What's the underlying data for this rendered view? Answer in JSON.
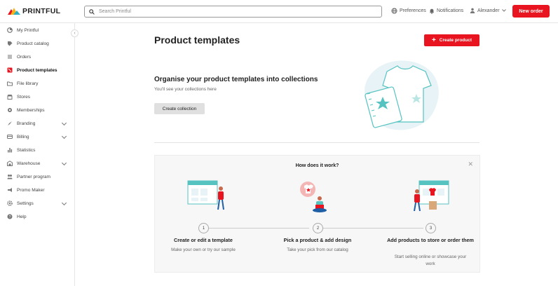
{
  "brand": {
    "name": "PRINTFUL",
    "accent": "#e8141f",
    "teal": "#56c3c1"
  },
  "header": {
    "search_placeholder": "Search Printful",
    "preferences": "Preferences",
    "notifications": "Notifications",
    "user": "Alexander",
    "new_order": "New order"
  },
  "sidebar": {
    "items": [
      {
        "label": "My Printful",
        "icon": "dashboard-icon"
      },
      {
        "label": "Product catalog",
        "icon": "tag-icon"
      },
      {
        "label": "Orders",
        "icon": "list-icon"
      },
      {
        "label": "Product templates",
        "icon": "template-icon",
        "active": true
      },
      {
        "label": "File library",
        "icon": "folder-icon"
      },
      {
        "label": "Stores",
        "icon": "store-icon"
      },
      {
        "label": "Memberships",
        "icon": "gear-badge-icon"
      },
      {
        "label": "Branding",
        "icon": "brush-icon",
        "expandable": true
      },
      {
        "label": "Billing",
        "icon": "card-icon",
        "expandable": true
      },
      {
        "label": "Statistics",
        "icon": "bar-chart-icon"
      },
      {
        "label": "Warehouse",
        "icon": "warehouse-icon",
        "expandable": true
      },
      {
        "label": "Partner program",
        "icon": "handshake-icon"
      },
      {
        "label": "Promo Maker",
        "icon": "megaphone-icon"
      },
      {
        "label": "Settings",
        "icon": "gear-icon",
        "expandable": true
      },
      {
        "label": "Help",
        "icon": "help-icon"
      }
    ]
  },
  "main": {
    "title": "Product templates",
    "create_product": "Create product",
    "org_title": "Organise your product templates into collections",
    "org_sub": "You'll see your collections here",
    "create_collection": "Create collection"
  },
  "how": {
    "title": "How does it work?",
    "steps": [
      {
        "num": "1",
        "title": "Create or edit a template",
        "desc": "Make your own or try our sample"
      },
      {
        "num": "2",
        "title": "Pick a product & add design",
        "desc": "Take your pick from our catalog"
      },
      {
        "num": "3",
        "title": "Add products to store or order them",
        "desc": "Start selling online or showcase your work"
      }
    ]
  }
}
